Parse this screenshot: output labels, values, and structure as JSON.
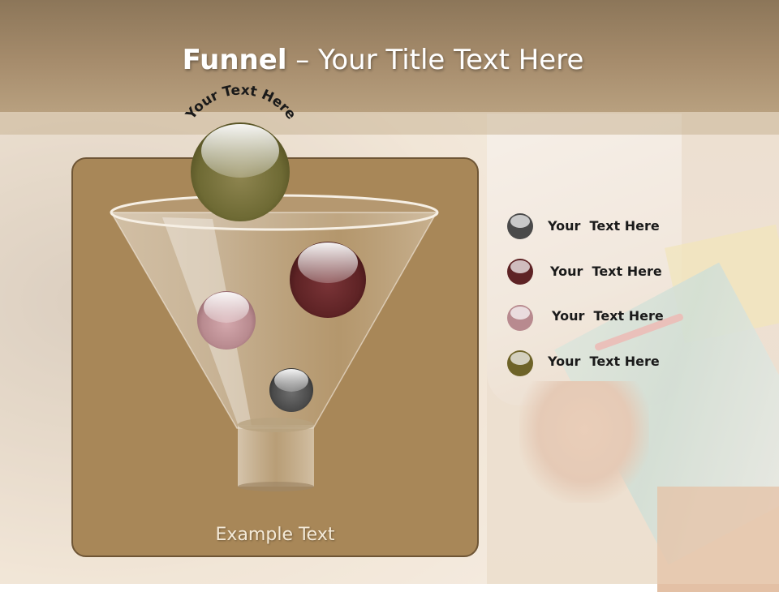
{
  "slide": {
    "title_bold": "Funnel",
    "title_rest": " – Your Title Text Here",
    "arc_text": "Your Text Here",
    "example_text": "Example Text"
  },
  "legend": [
    {
      "label": "Your  Text Here",
      "color": "#4a4a4a"
    },
    {
      "label": "Your  Text Here",
      "color": "#5e2325"
    },
    {
      "label": "Your  Text Here",
      "color": "#b88a8f"
    },
    {
      "label": "Your  Text Here",
      "color": "#6e6328"
    }
  ],
  "colors": {
    "title_bar": "#a68c6c",
    "panel": "#a88758",
    "top_ball": "#6e6a34"
  }
}
